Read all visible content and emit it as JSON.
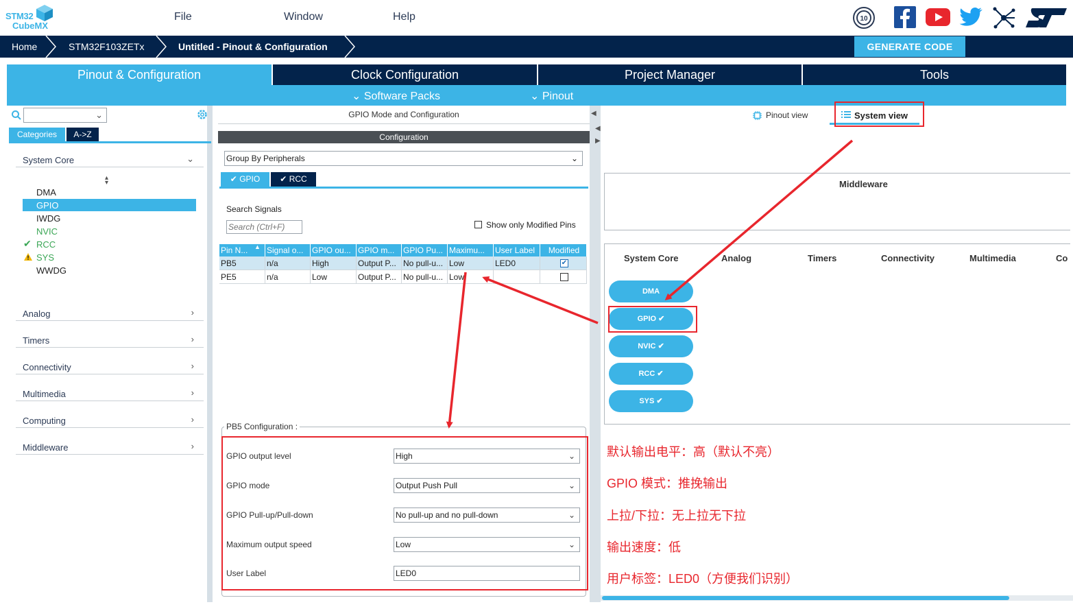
{
  "app": {
    "logo_line1": "STM32",
    "logo_line2": "CubeMX"
  },
  "menu": [
    "File",
    "Window",
    "Help"
  ],
  "breadcrumb": [
    "Home",
    "STM32F103ZETx",
    "Untitled - Pinout & Configuration"
  ],
  "generate_label": "GENERATE CODE",
  "main_tabs": [
    "Pinout & Configuration",
    "Clock Configuration",
    "Project Manager",
    "Tools"
  ],
  "sub_menu": [
    "Software Packs",
    "Pinout"
  ],
  "left": {
    "tabs": [
      "Categories",
      "A->Z"
    ],
    "groups": [
      "System Core",
      "Analog",
      "Timers",
      "Connectivity",
      "Multimedia",
      "Computing",
      "Middleware"
    ],
    "items": [
      "DMA",
      "GPIO",
      "IWDG",
      "NVIC",
      "RCC",
      "SYS",
      "WWDG"
    ]
  },
  "middle": {
    "title": "GPIO Mode and Configuration",
    "config_header": "Configuration",
    "group_by": "Group By Peripherals",
    "tabs": [
      "GPIO",
      "RCC"
    ],
    "search_label": "Search Signals",
    "search_placeholder": "Search (Ctrl+F)",
    "show_modified": "Show only Modified Pins",
    "columns": [
      "Pin N...",
      "Signal o...",
      "GPIO ou...",
      "GPIO m...",
      "GPIO Pu...",
      "Maximu...",
      "User Label",
      "Modified"
    ],
    "rows": [
      {
        "pin": "PB5",
        "signal": "n/a",
        "level": "High",
        "mode": "Output P...",
        "pull": "No pull-u...",
        "speed": "Low",
        "label": "LED0",
        "modified": true
      },
      {
        "pin": "PE5",
        "signal": "n/a",
        "level": "Low",
        "mode": "Output P...",
        "pull": "No pull-u...",
        "speed": "Low",
        "label": "",
        "modified": false
      }
    ],
    "pb5_title": "PB5 Configuration :",
    "fields": [
      {
        "label": "GPIO output level",
        "value": "High"
      },
      {
        "label": "GPIO mode",
        "value": "Output Push Pull"
      },
      {
        "label": "GPIO Pull-up/Pull-down",
        "value": "No pull-up and no pull-down"
      },
      {
        "label": "Maximum output speed",
        "value": "Low"
      },
      {
        "label": "User Label",
        "value": "LED0"
      }
    ]
  },
  "right": {
    "view_tabs": [
      "Pinout view",
      "System view"
    ],
    "middleware": "Middleware",
    "categories": [
      "System Core",
      "Analog",
      "Timers",
      "Connectivity",
      "Multimedia",
      "Co"
    ],
    "pills": [
      "DMA",
      "GPIO",
      "NVIC",
      "RCC",
      "SYS"
    ]
  },
  "notes": [
    "默认输出电平：高（默认不亮）",
    "GPIO 模式：推挽输出",
    "上拉/下拉：无上拉无下拉",
    "输出速度：低",
    "用户标签：LED0（方便我们识别）"
  ],
  "colors": {
    "navy": "#03234b",
    "accent": "#3cb4e6",
    "annotation": "#e8262d",
    "warning": "#f2b705",
    "ok": "#3aa655"
  }
}
